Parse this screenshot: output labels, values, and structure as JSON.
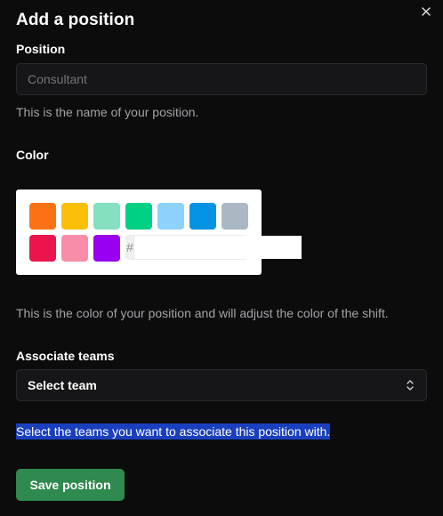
{
  "dialog": {
    "title": "Add a position",
    "close_icon": "close-icon"
  },
  "position": {
    "label": "Position",
    "placeholder": "Consultant",
    "value": "",
    "help": "This is the name of your position."
  },
  "color": {
    "label": "Color",
    "swatches": [
      "#f97316",
      "#fbbf09",
      "#86e0c0",
      "#00d084",
      "#8ed1fc",
      "#0693e3",
      "#abb8c3",
      "#eb144c",
      "#f78da7",
      "#9900ef"
    ],
    "hex_prefix": "#",
    "hex_value": "",
    "help": "This is the color of your position and will adjust the color of the shift."
  },
  "teams": {
    "label": "Associate teams",
    "selected": "Select team",
    "select_icon": "chevron-up-down-icon",
    "help": "Select the teams you want to associate this position with."
  },
  "actions": {
    "save_label": "Save position",
    "save_color": "#2e8a4e"
  }
}
